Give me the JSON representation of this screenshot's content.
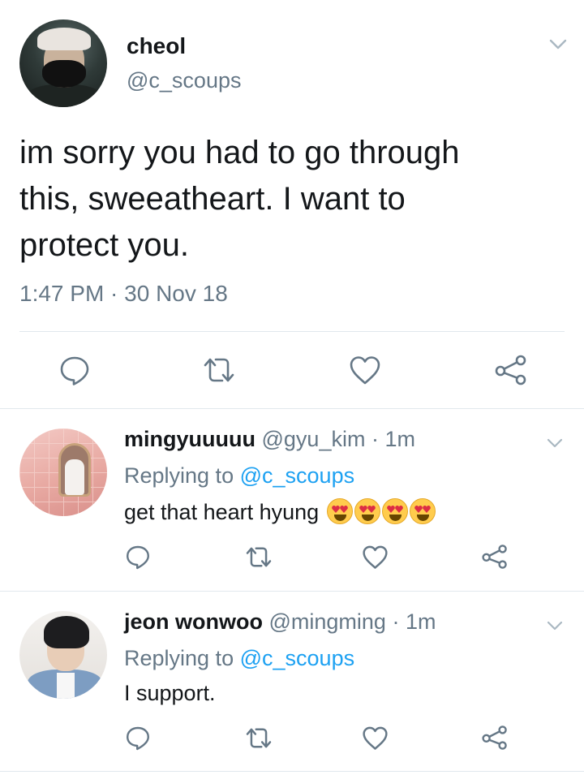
{
  "main_tweet": {
    "display_name": "cheol",
    "handle": "@c_scoups",
    "text_lines": [
      "im sorry you had to go through",
      "this, sweeatheart. I want to",
      "protect you."
    ],
    "timestamp": "1:47 PM · 30 Nov 18",
    "actions": [
      "reply-icon",
      "retweet-icon",
      "like-icon",
      "share-icon"
    ]
  },
  "replies": [
    {
      "display_name": "mingyuuuuu",
      "meta": "@gyu_kim · 1m",
      "replying_prefix": "Replying to",
      "replying_mention": "@c_scoups",
      "text": "get that heart hyung",
      "emoji": [
        "heart-eyes-emoji",
        "heart-eyes-emoji",
        "heart-eyes-emoji",
        "heart-eyes-emoji"
      ]
    },
    {
      "display_name": "jeon wonwoo",
      "meta": "@mingming · 1m",
      "replying_prefix": "Replying to",
      "replying_mention": "@c_scoups",
      "text": "I support."
    }
  ],
  "colors": {
    "text": "#14171a",
    "secondary": "#657786",
    "accent": "#1da1f2",
    "divider": "#e1e8ed",
    "icon": "#657786"
  }
}
